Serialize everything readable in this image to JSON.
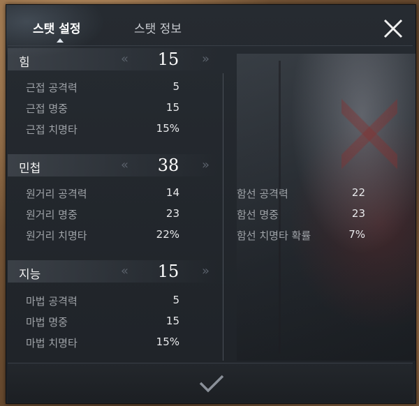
{
  "tabs": [
    {
      "label": "스탯 설정"
    },
    {
      "label": "스탯 정보"
    }
  ],
  "stats": [
    {
      "name": "힘",
      "value": "15",
      "rows": [
        {
          "label": "근접 공격력",
          "value": "5"
        },
        {
          "label": "근접 명중",
          "value": "15"
        },
        {
          "label": "근접 치명타",
          "value": "15%"
        }
      ]
    },
    {
      "name": "민첩",
      "value": "38",
      "rows": [
        {
          "label": "원거리 공격력",
          "value": "14"
        },
        {
          "label": "원거리 명중",
          "value": "23"
        },
        {
          "label": "원거리 치명타",
          "value": "22%"
        }
      ]
    },
    {
      "name": "지능",
      "value": "15",
      "rows": [
        {
          "label": "마법 공격력",
          "value": "5"
        },
        {
          "label": "마법 명중",
          "value": "15"
        },
        {
          "label": "마법 치명타",
          "value": "15%"
        }
      ]
    }
  ],
  "ship_stats": [
    {
      "label": "함선 공격력",
      "value": "22"
    },
    {
      "label": "함선 명중",
      "value": "23"
    },
    {
      "label": "함선 치명타 확률",
      "value": "7%"
    }
  ],
  "icons": {
    "decrease": "double-chevron-left-icon",
    "increase": "double-chevron-right-icon",
    "close": "close-x-icon",
    "confirm": "checkmark-icon"
  },
  "colors": {
    "panel_bg": "#23272c",
    "text_primary": "#ffffff",
    "text_label": "#9fa3a8",
    "arrow": "#5a616b"
  }
}
